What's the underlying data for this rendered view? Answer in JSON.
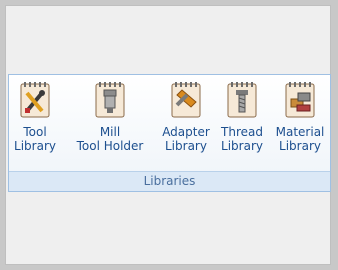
{
  "ribbon": {
    "group_label": "Libraries",
    "buttons": [
      {
        "line1": "Tool",
        "line2": "Library",
        "icon": "tool-library-icon"
      },
      {
        "line1": "Mill",
        "line2": "Tool Holder",
        "icon": "mill-tool-holder-icon"
      },
      {
        "line1": "Adapter",
        "line2": "Library",
        "icon": "adapter-library-icon"
      },
      {
        "line1": "Thread",
        "line2": "Library",
        "icon": "thread-library-icon"
      },
      {
        "line1": "Material",
        "line2": "Library",
        "icon": "material-library-icon"
      }
    ]
  }
}
